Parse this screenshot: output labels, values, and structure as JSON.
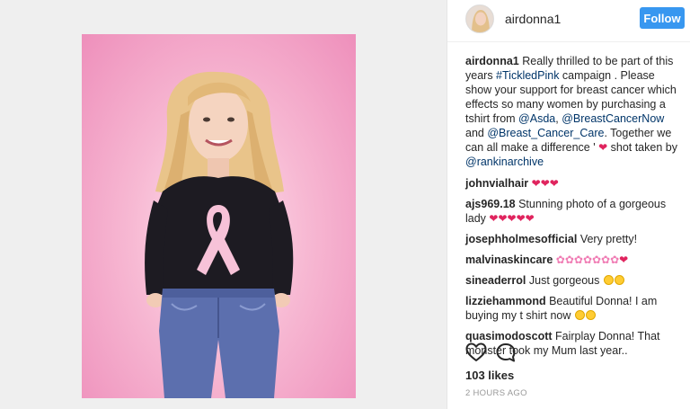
{
  "post": {
    "username": "airdonna1",
    "follow_label": "Follow"
  },
  "caption": {
    "username": "airdonna1",
    "text_1": " Really thrilled to be part of this years ",
    "hashtag": "#TickledPink",
    "text_2": " campaign . Please show your support for breast cancer which effects so many women by purchasing a tshirt from ",
    "mention_1": "@Asda",
    "sep_1": ", ",
    "mention_2": "@BreastCancerNow",
    "sep_2": " and ",
    "mention_3": "@Breast_Cancer_Care",
    "text_3": ". Together we can all make a difference ' ",
    "emoji": "❤",
    "text_4": " shot taken by ",
    "mention_4": "@rankinarchive"
  },
  "comments": [
    {
      "username": "johnvialhair",
      "text": " ",
      "emoji": "❤❤❤"
    },
    {
      "username": "ajs969.18",
      "text": " Stunning photo of a gorgeous lady ",
      "emoji": "❤❤❤❤❤"
    },
    {
      "username": "josephholmesofficial",
      "text": " Very pretty!",
      "emoji": ""
    },
    {
      "username": "malvinaskincare",
      "text": " ",
      "emoji": "✿✿✿✿✿✿✿",
      "emoji_end": "❤"
    },
    {
      "username": "sineaderrol",
      "text": " Just gorgeous ",
      "emoji": ""
    },
    {
      "username": "lizziehammond",
      "text": " Beautiful Donna! I am buying my t shirt now ",
      "emoji": ""
    },
    {
      "username": "quasimodoscott",
      "text": " Fairplay Donna! That monster took my Mum last year..",
      "emoji": ""
    }
  ],
  "actions": {
    "like_icon": "heart-outline-icon",
    "comment_icon": "comment-bubble-icon"
  },
  "likes": "103 likes",
  "timestamp": "2 HOURS AGO",
  "colors": {
    "follow_button": "#3897f0",
    "link": "#003569",
    "photo_background": "#f4a9cb"
  }
}
